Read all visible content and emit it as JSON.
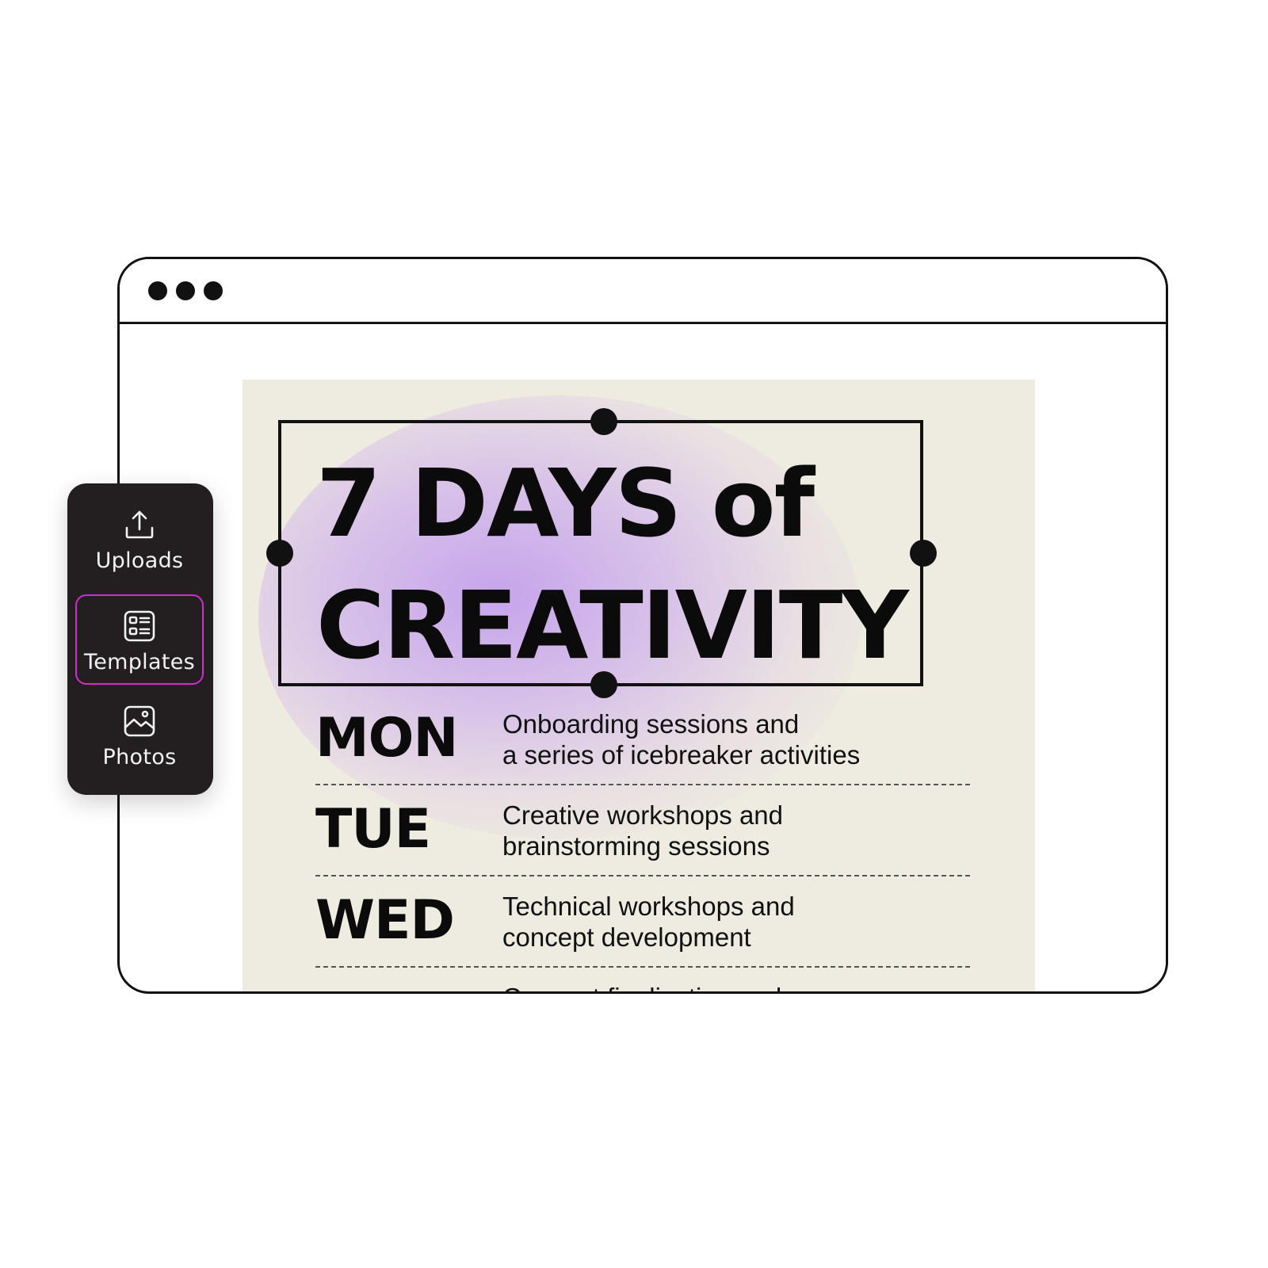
{
  "poster": {
    "title_line1": "7 DAYS of",
    "title_line2": "CREATIVITY",
    "schedule": [
      {
        "day": "MON",
        "line1": "Onboarding sessions and",
        "line2": "a series of icebreaker activities"
      },
      {
        "day": "TUE",
        "line1": "Creative workshops and",
        "line2": "brainstorming sessions"
      },
      {
        "day": "WED",
        "line1": "Technical workshops and",
        "line2": "concept development"
      },
      {
        "day": "",
        "line1": "Concept finalization and",
        "line2": ""
      }
    ]
  },
  "sidebar": {
    "items": [
      {
        "label": "Uploads",
        "icon": "upload-icon"
      },
      {
        "label": "Templates",
        "icon": "templates-icon",
        "selected": true
      },
      {
        "label": "Photos",
        "icon": "photo-icon"
      }
    ]
  },
  "colors": {
    "selected_outline": "#d12ad1",
    "sidebar_bg": "#231f20",
    "poster_bg": "#eeece0",
    "glow": "#c4a0ec"
  }
}
